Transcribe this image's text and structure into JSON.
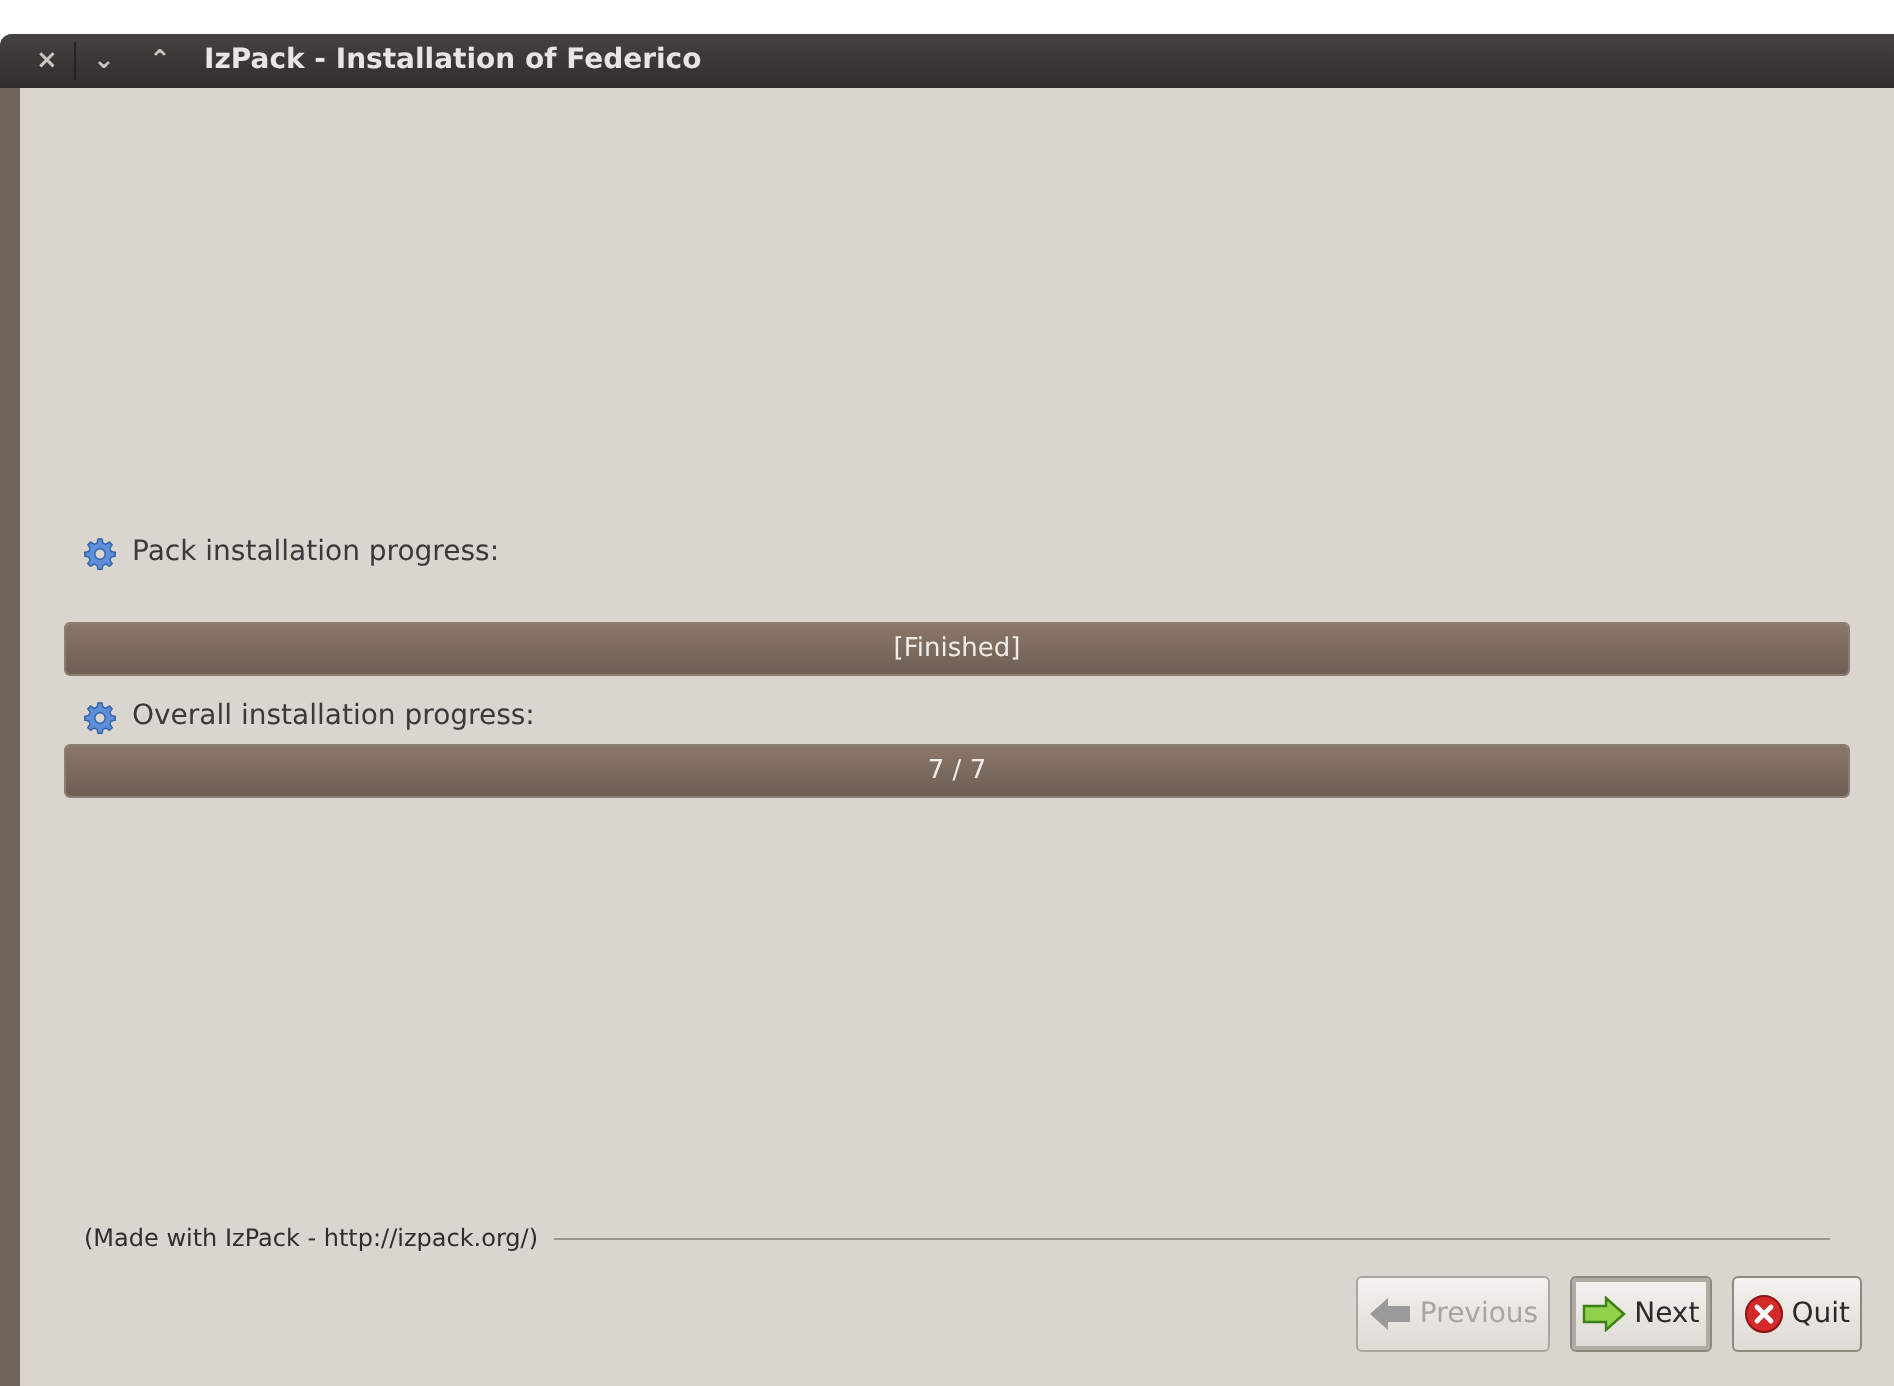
{
  "window": {
    "title": "IzPack - Installation of Federico",
    "controls": [
      "×",
      "⌄",
      "⌃"
    ]
  },
  "progress": [
    {
      "label": "Pack installation progress:",
      "level": 1,
      "reading": "[Finished]"
    },
    {
      "label": "Overall installation progress:",
      "level": 1,
      "reading": "7 / 7"
    }
  ],
  "footer": "(Made with IzPack - http://izpack.org/)",
  "buttons": [
    {
      "kind": "previous",
      "label": "Previous",
      "disabled": true,
      "focused": false
    },
    {
      "kind": "next",
      "label": "Next",
      "disabled": false,
      "focused": true
    },
    {
      "kind": "quit",
      "label": "Quit",
      "disabled": false,
      "focused": false
    }
  ]
}
